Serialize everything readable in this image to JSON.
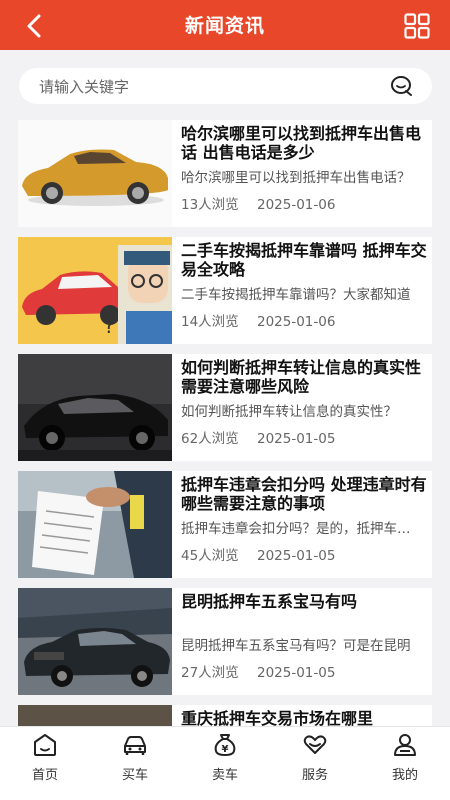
{
  "header": {
    "title": "新闻资讯"
  },
  "search": {
    "placeholder": "请输入关键字"
  },
  "articles": [
    {
      "title": "哈尔滨哪里可以找到抵押车出售电话 出售电话是多少",
      "summary": "哈尔滨哪里可以找到抵押车出售电话？",
      "views": "13人浏览",
      "date": "2025-01-06"
    },
    {
      "title": "二手车按揭抵押车靠谱吗 抵押车交易全攻略",
      "summary": "二手车按揭抵押车靠谱吗？大家都知道",
      "views": "14人浏览",
      "date": "2025-01-06"
    },
    {
      "title": "如何判断抵押车转让信息的真实性 需要注意哪些风险",
      "summary": "如何判断抵押车转让信息的真实性？",
      "views": "62人浏览",
      "date": "2025-01-05"
    },
    {
      "title": "抵押车违章会扣分吗 处理违章时有哪些需要注意的事项",
      "summary": "抵押车违章会扣分吗？是的，抵押车违章",
      "views": "45人浏览",
      "date": "2025-01-05"
    },
    {
      "title": "昆明抵押车五系宝马有吗",
      "summary": "昆明抵押车五系宝马有吗？可是在昆明",
      "views": "27人浏览",
      "date": "2025-01-05"
    },
    {
      "title": "重庆抵押车交易市场在哪里",
      "summary": "",
      "views": "",
      "date": ""
    }
  ],
  "tabbar": [
    {
      "label": "首页",
      "icon": "home-icon"
    },
    {
      "label": "买车",
      "icon": "car-icon"
    },
    {
      "label": "卖车",
      "icon": "money-bag-icon"
    },
    {
      "label": "服务",
      "icon": "heart-hands-icon"
    },
    {
      "label": "我的",
      "icon": "user-icon"
    }
  ],
  "colors": {
    "brand": "#e8472a",
    "background": "#f2f2f4"
  }
}
